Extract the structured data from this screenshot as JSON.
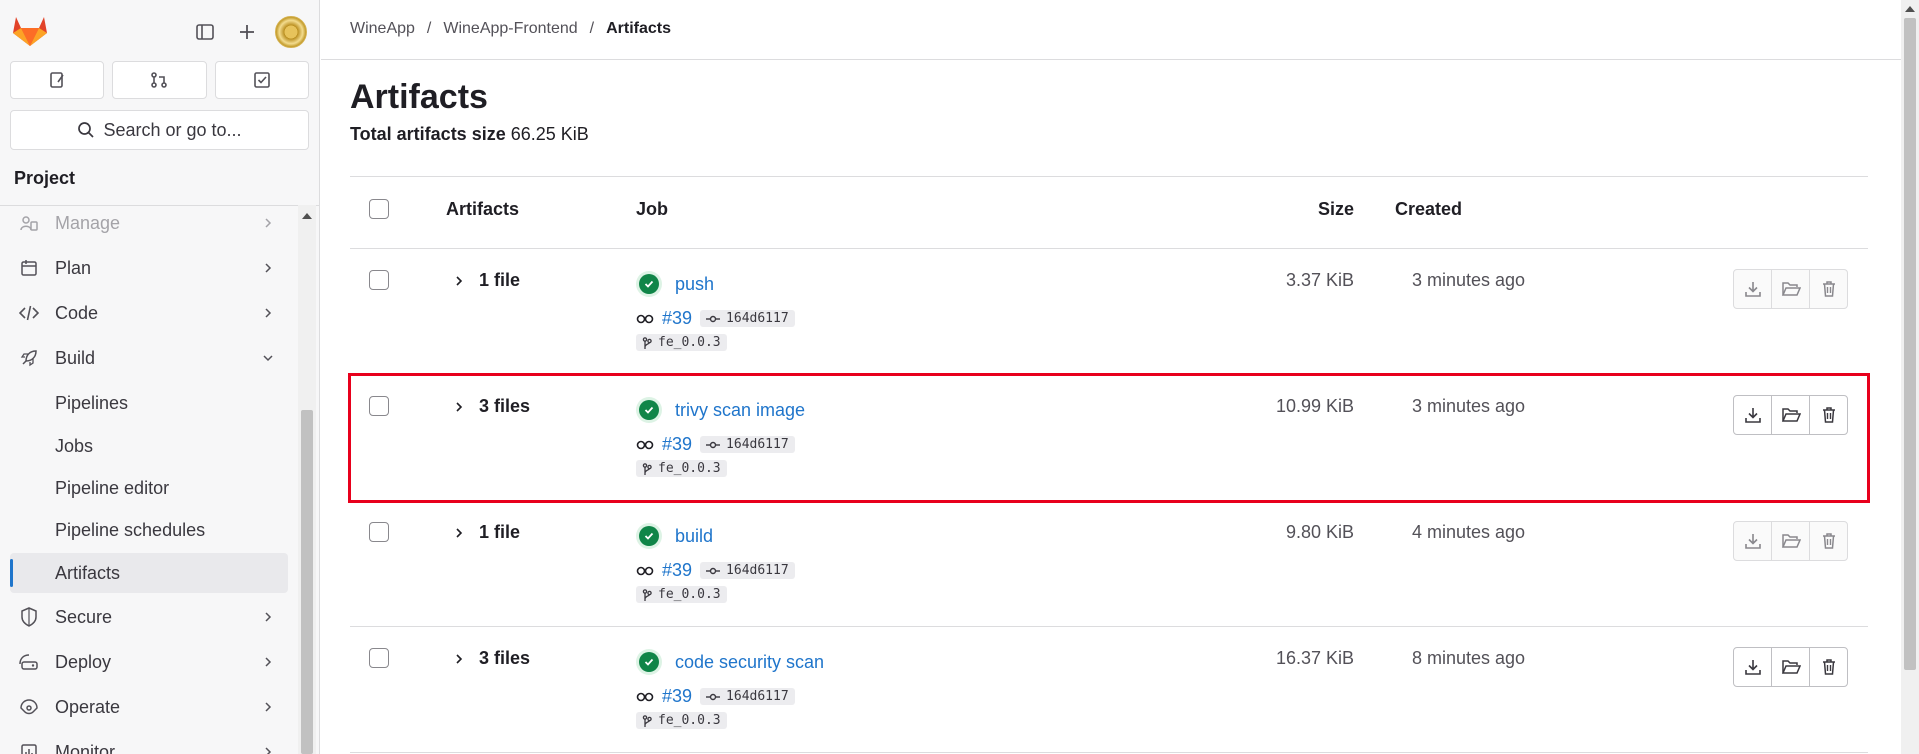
{
  "sidebar": {
    "search_label": "Search or go to...",
    "section": "Project",
    "items": [
      {
        "label": "Manage",
        "icon": "users-icon",
        "chevron": "right"
      },
      {
        "label": "Plan",
        "icon": "plan-icon",
        "chevron": "right"
      },
      {
        "label": "Code",
        "icon": "code-icon",
        "chevron": "right"
      },
      {
        "label": "Build",
        "icon": "rocket-icon",
        "chevron": "down"
      },
      {
        "label": "Pipelines"
      },
      {
        "label": "Jobs"
      },
      {
        "label": "Pipeline editor"
      },
      {
        "label": "Pipeline schedules"
      },
      {
        "label": "Artifacts"
      },
      {
        "label": "Secure",
        "icon": "shield-icon",
        "chevron": "right"
      },
      {
        "label": "Deploy",
        "icon": "deploy-icon",
        "chevron": "right"
      },
      {
        "label": "Operate",
        "icon": "operate-icon",
        "chevron": "right"
      },
      {
        "label": "Monitor",
        "icon": "monitor-icon",
        "chevron": "right"
      }
    ]
  },
  "breadcrumb": {
    "group": "WineApp",
    "sep1": "/",
    "project": "WineApp-Frontend",
    "sep2": "/",
    "current": "Artifacts"
  },
  "page": {
    "title": "Artifacts",
    "total_label": "Total artifacts size",
    "total_value": "66.25 KiB"
  },
  "table": {
    "headers": {
      "artifacts": "Artifacts",
      "job": "Job",
      "size": "Size",
      "created": "Created"
    },
    "rows": [
      {
        "count": "1 file",
        "job": "push",
        "pipeline": "#39",
        "commit": "164d6117",
        "branch": "fe_0.0.3",
        "size": "3.37 KiB",
        "created": "3 minutes ago"
      },
      {
        "count": "3 files",
        "job": "trivy scan image",
        "pipeline": "#39",
        "commit": "164d6117",
        "branch": "fe_0.0.3",
        "size": "10.99 KiB",
        "created": "3 minutes ago"
      },
      {
        "count": "1 file",
        "job": "build",
        "pipeline": "#39",
        "commit": "164d6117",
        "branch": "fe_0.0.3",
        "size": "9.80 KiB",
        "created": "4 minutes ago"
      },
      {
        "count": "3 files",
        "job": "code security scan",
        "pipeline": "#39",
        "commit": "164d6117",
        "branch": "fe_0.0.3",
        "size": "16.37 KiB",
        "created": "8 minutes ago"
      }
    ]
  },
  "colors": {
    "link": "#1f75cb",
    "success": "#108548",
    "highlight": "#e8001c"
  }
}
